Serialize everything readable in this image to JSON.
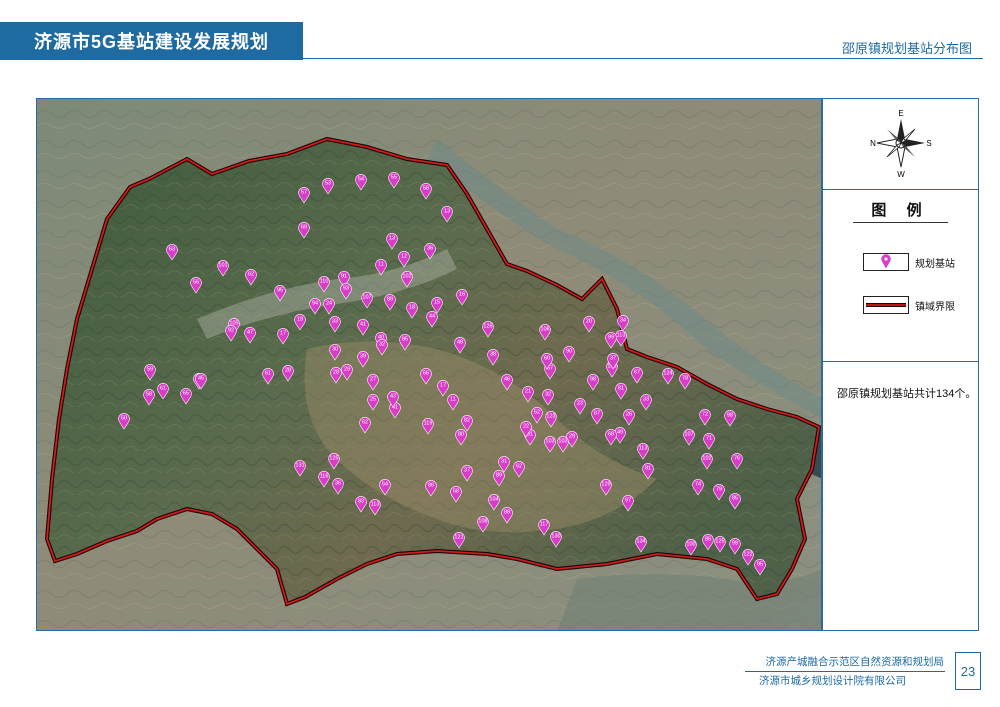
{
  "header": {
    "title": "济源市5G基站建设发展规划",
    "subtitle": "邵原镇规划基站分布图"
  },
  "compass": {
    "north": "N",
    "east": "E",
    "south": "S",
    "west": "W"
  },
  "legend": {
    "title": "图  例",
    "items": [
      {
        "label": "规划基站",
        "icon": "station-marker-icon",
        "color": "#d83cc8"
      },
      {
        "label": "镇域界限",
        "icon": "boundary-line-icon",
        "color": "#cc1111"
      }
    ]
  },
  "summary": "邵原镇规划基站共计134个。",
  "footer": {
    "org1": "济源产城融合示范区自然资源和规划局",
    "org2": "济源市城乡规划设计院有限公司",
    "page": "23"
  },
  "colors": {
    "accent": "#1e6aa1",
    "boundary": "#cc1111",
    "marker": "#d83cc8"
  },
  "stations": [
    {
      "n": "57"
    },
    {
      "n": "53"
    },
    {
      "n": "54"
    },
    {
      "n": "55"
    },
    {
      "n": "58"
    },
    {
      "n": "13"
    },
    {
      "n": "69"
    },
    {
      "n": "13"
    },
    {
      "n": "36"
    },
    {
      "n": "63"
    },
    {
      "n": "101"
    },
    {
      "n": "62"
    },
    {
      "n": "91"
    },
    {
      "n": "11"
    },
    {
      "n": "12"
    },
    {
      "n": "102"
    },
    {
      "n": "110"
    },
    {
      "n": "93"
    },
    {
      "n": "95"
    },
    {
      "n": "56"
    },
    {
      "n": "94"
    },
    {
      "n": "107"
    },
    {
      "n": "89"
    },
    {
      "n": "15"
    },
    {
      "n": "16"
    },
    {
      "n": "18"
    },
    {
      "n": "44"
    },
    {
      "n": "24"
    },
    {
      "n": "105"
    },
    {
      "n": "47"
    },
    {
      "n": "17"
    },
    {
      "n": "19"
    },
    {
      "n": "33"
    },
    {
      "n": "41"
    },
    {
      "n": "40"
    },
    {
      "n": "85"
    },
    {
      "n": "48"
    },
    {
      "n": "126"
    },
    {
      "n": "30"
    },
    {
      "n": "32"
    },
    {
      "n": "39"
    },
    {
      "n": "29"
    },
    {
      "n": "92"
    },
    {
      "n": "115"
    },
    {
      "n": "61"
    },
    {
      "n": "58"
    },
    {
      "n": "61"
    },
    {
      "n": "65"
    },
    {
      "n": "45"
    },
    {
      "n": "59"
    },
    {
      "n": "50"
    },
    {
      "n": "41"
    },
    {
      "n": "103"
    },
    {
      "n": "106"
    },
    {
      "n": "28"
    },
    {
      "n": "28"
    },
    {
      "n": "27"
    },
    {
      "n": "66"
    },
    {
      "n": "43"
    },
    {
      "n": "25"
    },
    {
      "n": "17"
    },
    {
      "n": "11"
    },
    {
      "n": "62"
    },
    {
      "n": "119"
    },
    {
      "n": "82"
    },
    {
      "n": "80"
    },
    {
      "n": "31"
    },
    {
      "n": "29"
    },
    {
      "n": "32"
    },
    {
      "n": "23"
    },
    {
      "n": "125"
    },
    {
      "n": "131"
    },
    {
      "n": "116"
    },
    {
      "n": "36"
    },
    {
      "n": "83"
    },
    {
      "n": "113"
    },
    {
      "n": "64"
    },
    {
      "n": "121"
    },
    {
      "n": "108"
    },
    {
      "n": "117"
    },
    {
      "n": "130"
    },
    {
      "n": "104"
    },
    {
      "n": "88"
    },
    {
      "n": "86"
    },
    {
      "n": "58"
    },
    {
      "n": "89"
    },
    {
      "n": "37"
    },
    {
      "n": "31"
    },
    {
      "n": "62"
    },
    {
      "n": "22"
    },
    {
      "n": "21"
    },
    {
      "n": "52"
    },
    {
      "n": "123"
    },
    {
      "n": "103"
    },
    {
      "n": "87"
    },
    {
      "n": "81"
    },
    {
      "n": "67"
    },
    {
      "n": "26"
    },
    {
      "n": "33"
    },
    {
      "n": "49"
    },
    {
      "n": "113"
    },
    {
      "n": "81"
    },
    {
      "n": "97"
    },
    {
      "n": "124"
    },
    {
      "n": "78"
    },
    {
      "n": "72"
    },
    {
      "n": "98"
    },
    {
      "n": "107"
    },
    {
      "n": "71"
    },
    {
      "n": "102"
    },
    {
      "n": "76"
    },
    {
      "n": "74"
    },
    {
      "n": "79"
    },
    {
      "n": "85"
    },
    {
      "n": "129"
    },
    {
      "n": "134"
    },
    {
      "n": "100"
    },
    {
      "n": "85"
    },
    {
      "n": "125"
    },
    {
      "n": "99"
    },
    {
      "n": "122"
    },
    {
      "n": "95"
    },
    {
      "n": "68"
    },
    {
      "n": "57"
    },
    {
      "n": "38"
    },
    {
      "n": "46"
    },
    {
      "n": "60"
    },
    {
      "n": "90"
    },
    {
      "n": "98"
    },
    {
      "n": "135"
    },
    {
      "n": "113"
    },
    {
      "n": "99"
    },
    {
      "n": "34"
    },
    {
      "n": "37"
    },
    {
      "n": "20"
    }
  ]
}
